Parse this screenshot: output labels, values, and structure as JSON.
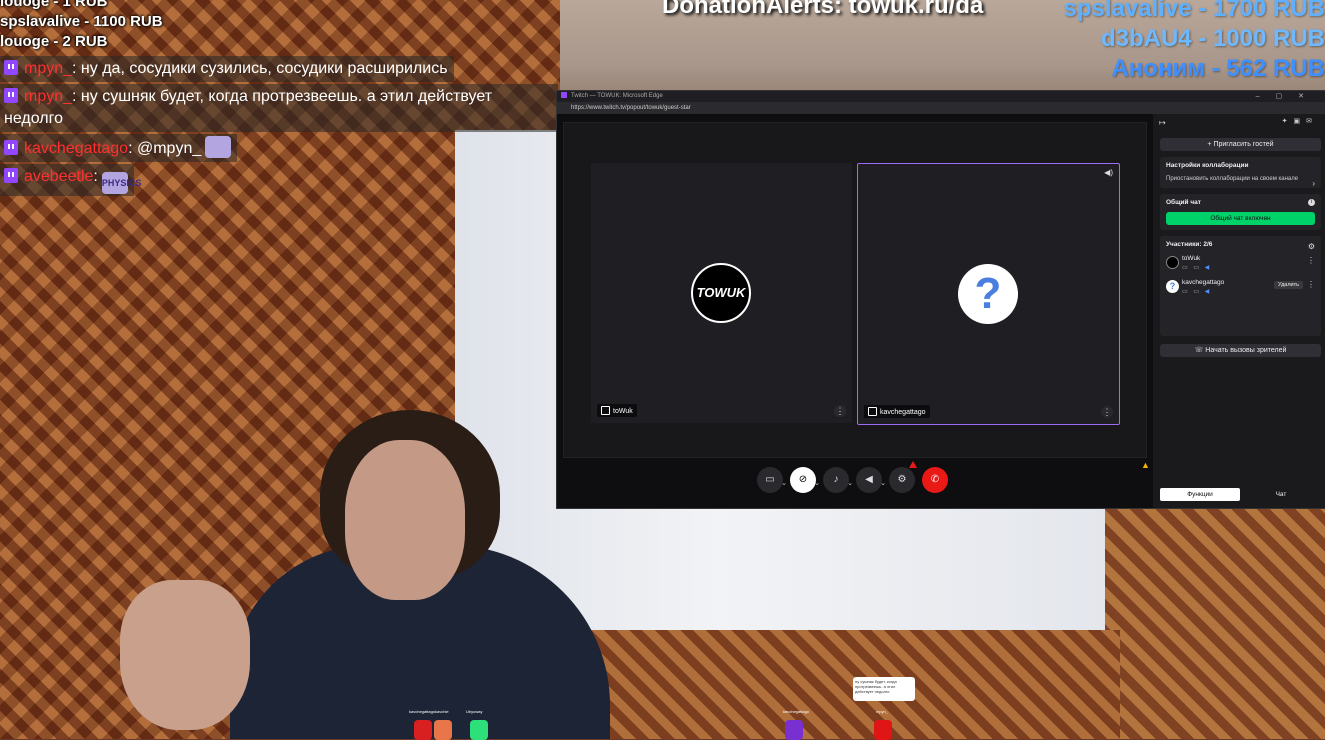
{
  "overlay": {
    "donation_list": [
      "louoge - 1 RUB",
      "spslavalive - 1100 RUB",
      "louoge - 2 RUB"
    ],
    "donation_link": "DonationAlerts: towuk.ru/da",
    "top_donors": [
      {
        "text": "spslavalive - 1700 RUB",
        "color": "#5fb0ff"
      },
      {
        "text": "d3bAU4 - 1000 RUB",
        "color": "#6db8ff"
      },
      {
        "text": "Аноним - 562 RUB",
        "color": "#3f8fff"
      }
    ]
  },
  "chat": [
    {
      "nick": "mpyn_",
      "text": ": ну да, сосудики сузились, сосудики расширились"
    },
    {
      "nick": "mpyn_",
      "text": ": ну сушняк будет, когда протрезвеешь. а этил действует недолго"
    },
    {
      "nick": "kavchegattago",
      "text": ": @mpyn_"
    },
    {
      "nick": "avebeetle",
      "text": ":",
      "emote": "PHYSICS"
    }
  ],
  "window": {
    "title": "Twitch — TOWUK: Microsoft Edge",
    "url": "https://www.twitch.tv/popout/towuk/guest-star",
    "tiles": [
      {
        "name": "toWuk",
        "avatar_text": "TOWUK"
      },
      {
        "name": "kavchegattago",
        "avatar_text": "?"
      }
    ],
    "panel": {
      "invite_label": "Пригласить гостей",
      "collab_header": "Настройки коллаборации",
      "collab_text": "Приостановить коллаборации на своем канале",
      "shared_chat_header": "Общий чат",
      "shared_chat_button": "Общий чат включен",
      "participants_header": "Участники: 2/6",
      "participants": [
        {
          "name": "toWuk"
        },
        {
          "name": "kavchegattago",
          "action": "Удалить"
        }
      ],
      "viewer_calls_label": "Начать вызовы зрителей",
      "tab_functions": "Функции",
      "tab_chat": "Чат"
    }
  },
  "bottom": {
    "speech_text": "ну сушняк будет, когда протрезвеешь. а этил действует недолго",
    "sprite_names": [
      "kavchegattagokavchie",
      "Ubyuway",
      "kavchegattago",
      "mpyn_"
    ]
  }
}
